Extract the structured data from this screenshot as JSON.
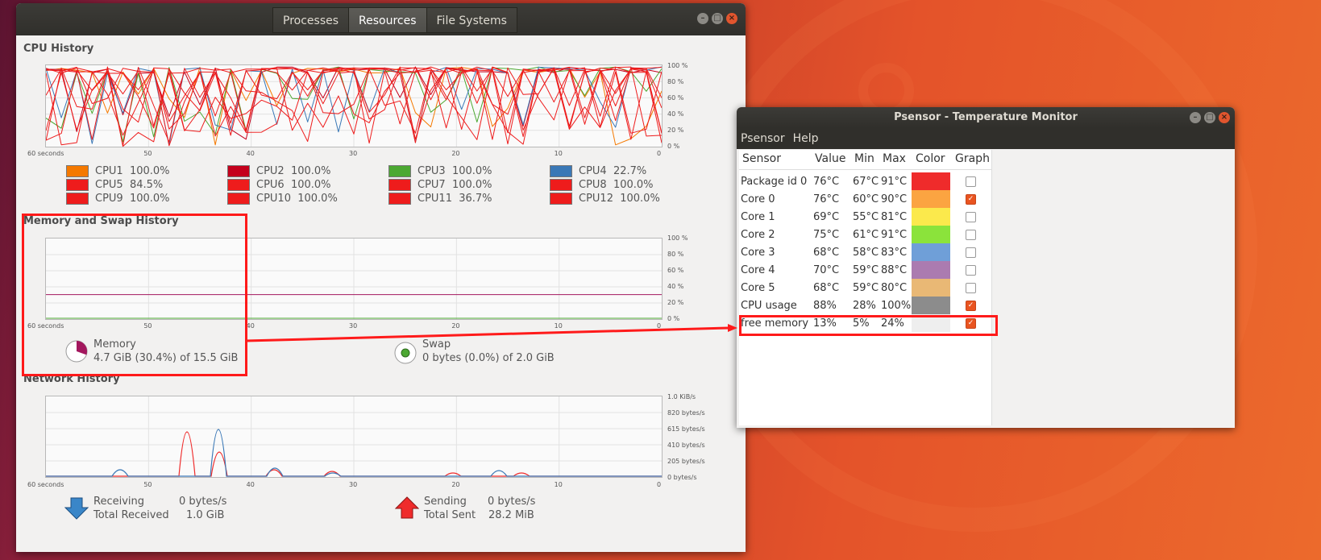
{
  "colors": {
    "accent": "#e95420",
    "highlight": "#ff1a1a"
  },
  "sysmon": {
    "tabs": [
      "Processes",
      "Resources",
      "File Systems"
    ],
    "cpu": {
      "title": "CPU History",
      "y_ticks": [
        "100 %",
        "80 %",
        "60 %",
        "40 %",
        "20 %",
        "0 %"
      ],
      "x_ticks": [
        "60 seconds",
        "50",
        "40",
        "30",
        "20",
        "10",
        "0"
      ],
      "legend": [
        {
          "label": "CPU1",
          "value": "100.0%",
          "color": "#f57900"
        },
        {
          "label": "CPU2",
          "value": "100.0%",
          "color": "#c4001c"
        },
        {
          "label": "CPU3",
          "value": "100.0%",
          "color": "#4ca832"
        },
        {
          "label": "CPU4",
          "value": "22.7%",
          "color": "#3a78b6"
        },
        {
          "label": "CPU5",
          "value": "84.5%",
          "color": "#ee1c1c"
        },
        {
          "label": "CPU6",
          "value": "100.0%",
          "color": "#ee1c1c"
        },
        {
          "label": "CPU7",
          "value": "100.0%",
          "color": "#ee1c1c"
        },
        {
          "label": "CPU8",
          "value": "100.0%",
          "color": "#ee1c1c"
        },
        {
          "label": "CPU9",
          "value": "100.0%",
          "color": "#ee1c1c"
        },
        {
          "label": "CPU10",
          "value": "100.0%",
          "color": "#ee1c1c"
        },
        {
          "label": "CPU11",
          "value": "36.7%",
          "color": "#ee1c1c"
        },
        {
          "label": "CPU12",
          "value": "100.0%",
          "color": "#ee1c1c"
        }
      ]
    },
    "memory": {
      "title": "Memory and Swap History",
      "y_ticks": [
        "100 %",
        "80 %",
        "60 %",
        "40 %",
        "20 %",
        "0 %"
      ],
      "x_ticks": [
        "60 seconds",
        "50",
        "40",
        "30",
        "20",
        "10",
        "0"
      ],
      "mem_label": "Memory",
      "mem_value": "4.7 GiB (30.4%) of 15.5 GiB",
      "mem_fraction": 0.304,
      "swap_label": "Swap",
      "swap_value": "0 bytes (0.0%) of 2.0 GiB",
      "swap_fraction": 0.0
    },
    "network": {
      "title": "Network History",
      "y_ticks": [
        "1.0 KiB/s",
        "820 bytes/s",
        "615 bytes/s",
        "410 bytes/s",
        "205 bytes/s",
        "0 bytes/s"
      ],
      "x_ticks": [
        "60 seconds",
        "50",
        "40",
        "30",
        "20",
        "10",
        "0"
      ],
      "recv_label": "Receiving",
      "recv_value": "0 bytes/s",
      "total_recv_label": "Total Received",
      "total_recv_value": "1.0 GiB",
      "send_label": "Sending",
      "send_value": "0 bytes/s",
      "total_sent_label": "Total Sent",
      "total_sent_value": "28.2 MiB"
    }
  },
  "psensor": {
    "title": "Psensor - Temperature Monitor",
    "menu": [
      "Psensor",
      "Help"
    ],
    "columns": [
      "Sensor",
      "Value",
      "Min",
      "Max",
      "Color",
      "Graph"
    ],
    "rows": [
      {
        "sensor": "Package id 0",
        "value": "76°C",
        "min": "67°C",
        "max": "91°C",
        "color": "#ef2b2b",
        "graph": false
      },
      {
        "sensor": "Core 0",
        "value": "76°C",
        "min": "60°C",
        "max": "90°C",
        "color": "#fba441",
        "graph": true
      },
      {
        "sensor": "Core 1",
        "value": "69°C",
        "min": "55°C",
        "max": "81°C",
        "color": "#fbe94c",
        "graph": false
      },
      {
        "sensor": "Core 2",
        "value": "75°C",
        "min": "61°C",
        "max": "91°C",
        "color": "#8be33b",
        "graph": false
      },
      {
        "sensor": "Core 3",
        "value": "68°C",
        "min": "58°C",
        "max": "83°C",
        "color": "#6f9fd8",
        "graph": false
      },
      {
        "sensor": "Core 4",
        "value": "70°C",
        "min": "59°C",
        "max": "88°C",
        "color": "#ab7bb0",
        "graph": false
      },
      {
        "sensor": "Core 5",
        "value": "68°C",
        "min": "59°C",
        "max": "80°C",
        "color": "#e9b875",
        "graph": false
      },
      {
        "sensor": "CPU usage",
        "value": "88%",
        "min": "28%",
        "max": "100%",
        "color": "#8c8c8c",
        "graph": true
      },
      {
        "sensor": "free memory",
        "value": "13%",
        "min": "5%",
        "max": "24%",
        "color": "#eeeeee",
        "graph": true
      }
    ]
  }
}
